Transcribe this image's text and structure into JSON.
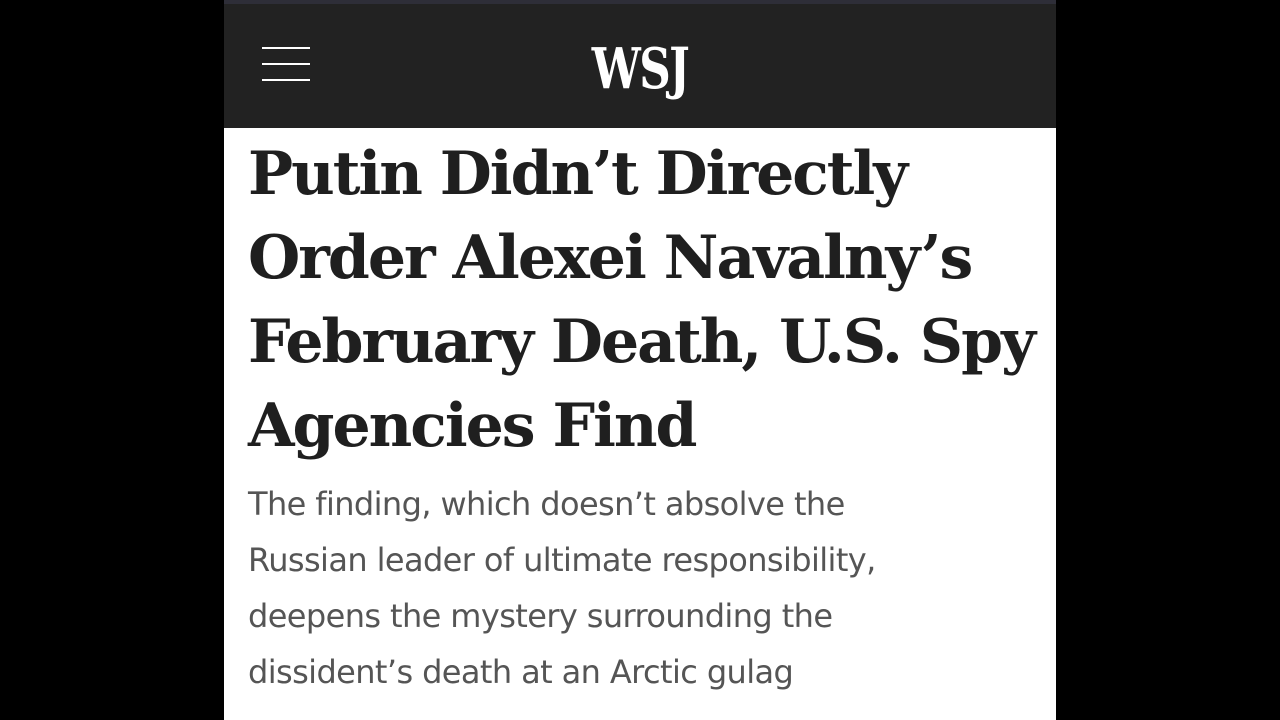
{
  "header": {
    "logo_text": "WSJ",
    "menu_icon": "hamburger-menu-icon",
    "background_color": "#222222"
  },
  "article": {
    "headline_lines": [
      "Putin Didn’t Directly",
      "Order Alexei Navalny’s",
      "February Death, U.S. Spy",
      "Agencies Find"
    ],
    "dek_lines": [
      "The finding, which doesn’t absolve the",
      "Russian leader of ultimate responsibility,",
      "deepens the mystery surrounding the",
      "dissident’s death at an Arctic gulag"
    ],
    "headline_color": "#1f1f1f",
    "dek_color": "#555555"
  }
}
